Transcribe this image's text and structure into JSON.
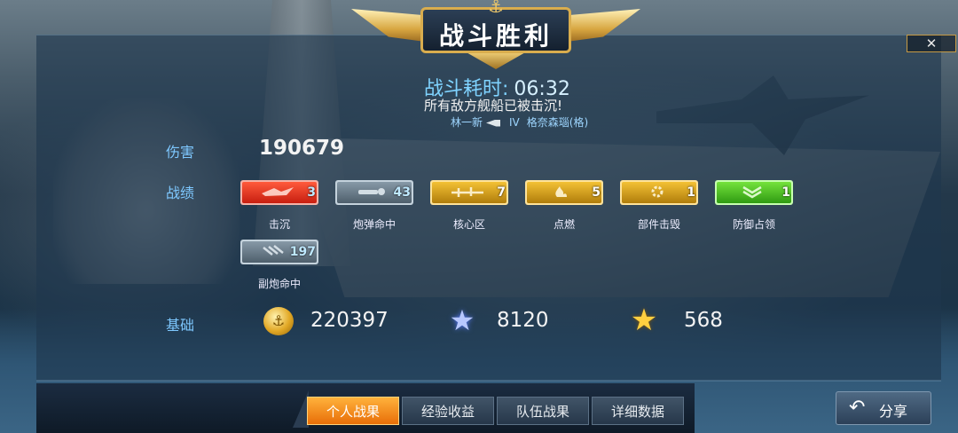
{
  "header": {
    "title": "战斗胜利",
    "close_icon": "close-icon"
  },
  "battle": {
    "duration_label": "战斗耗时:",
    "duration_value": "06:32",
    "sunk_message": "所有敌方舰船已被击沉!",
    "sinker_player": "林一新",
    "target_tier": "IV",
    "target_ship": "格奈森瑙(格)"
  },
  "stats": {
    "damage_label": "伤害",
    "damage_value": "190679",
    "medals_label": "战绩",
    "medals": [
      {
        "name": "击沉",
        "count": "3",
        "color": "#e0321c",
        "icon": "ship-sunk-icon"
      },
      {
        "name": "炮弹命中",
        "count": "43",
        "color": "#6c7f8e",
        "icon": "shell-hit-icon"
      },
      {
        "name": "核心区",
        "count": "7",
        "color": "#e3a51e",
        "icon": "citadel-icon"
      },
      {
        "name": "点燃",
        "count": "5",
        "color": "#e3a51e",
        "icon": "fire-icon"
      },
      {
        "name": "部件击毁",
        "count": "1",
        "color": "#e3a51e",
        "icon": "gear-icon"
      },
      {
        "name": "防御占领",
        "count": "1",
        "color": "#52c62a",
        "icon": "chevron-down-icon"
      },
      {
        "name": "副炮命中",
        "count": "197",
        "color": "#6c7f8e",
        "icon": "secondary-hit-icon"
      }
    ],
    "base_label": "基础",
    "credits": "220397",
    "free_xp": "8120",
    "captain_xp": "568"
  },
  "tabs": [
    {
      "label": "个人战果",
      "active": true
    },
    {
      "label": "经验收益",
      "active": false
    },
    {
      "label": "队伍战果",
      "active": false
    },
    {
      "label": "详细数据",
      "active": false
    }
  ],
  "share": {
    "label": "分享",
    "icon": "share-arrow-icon"
  },
  "colors": {
    "accent": "#7ec8ff",
    "tab_active": "#f28a14",
    "gold": "#d9ad4e"
  }
}
